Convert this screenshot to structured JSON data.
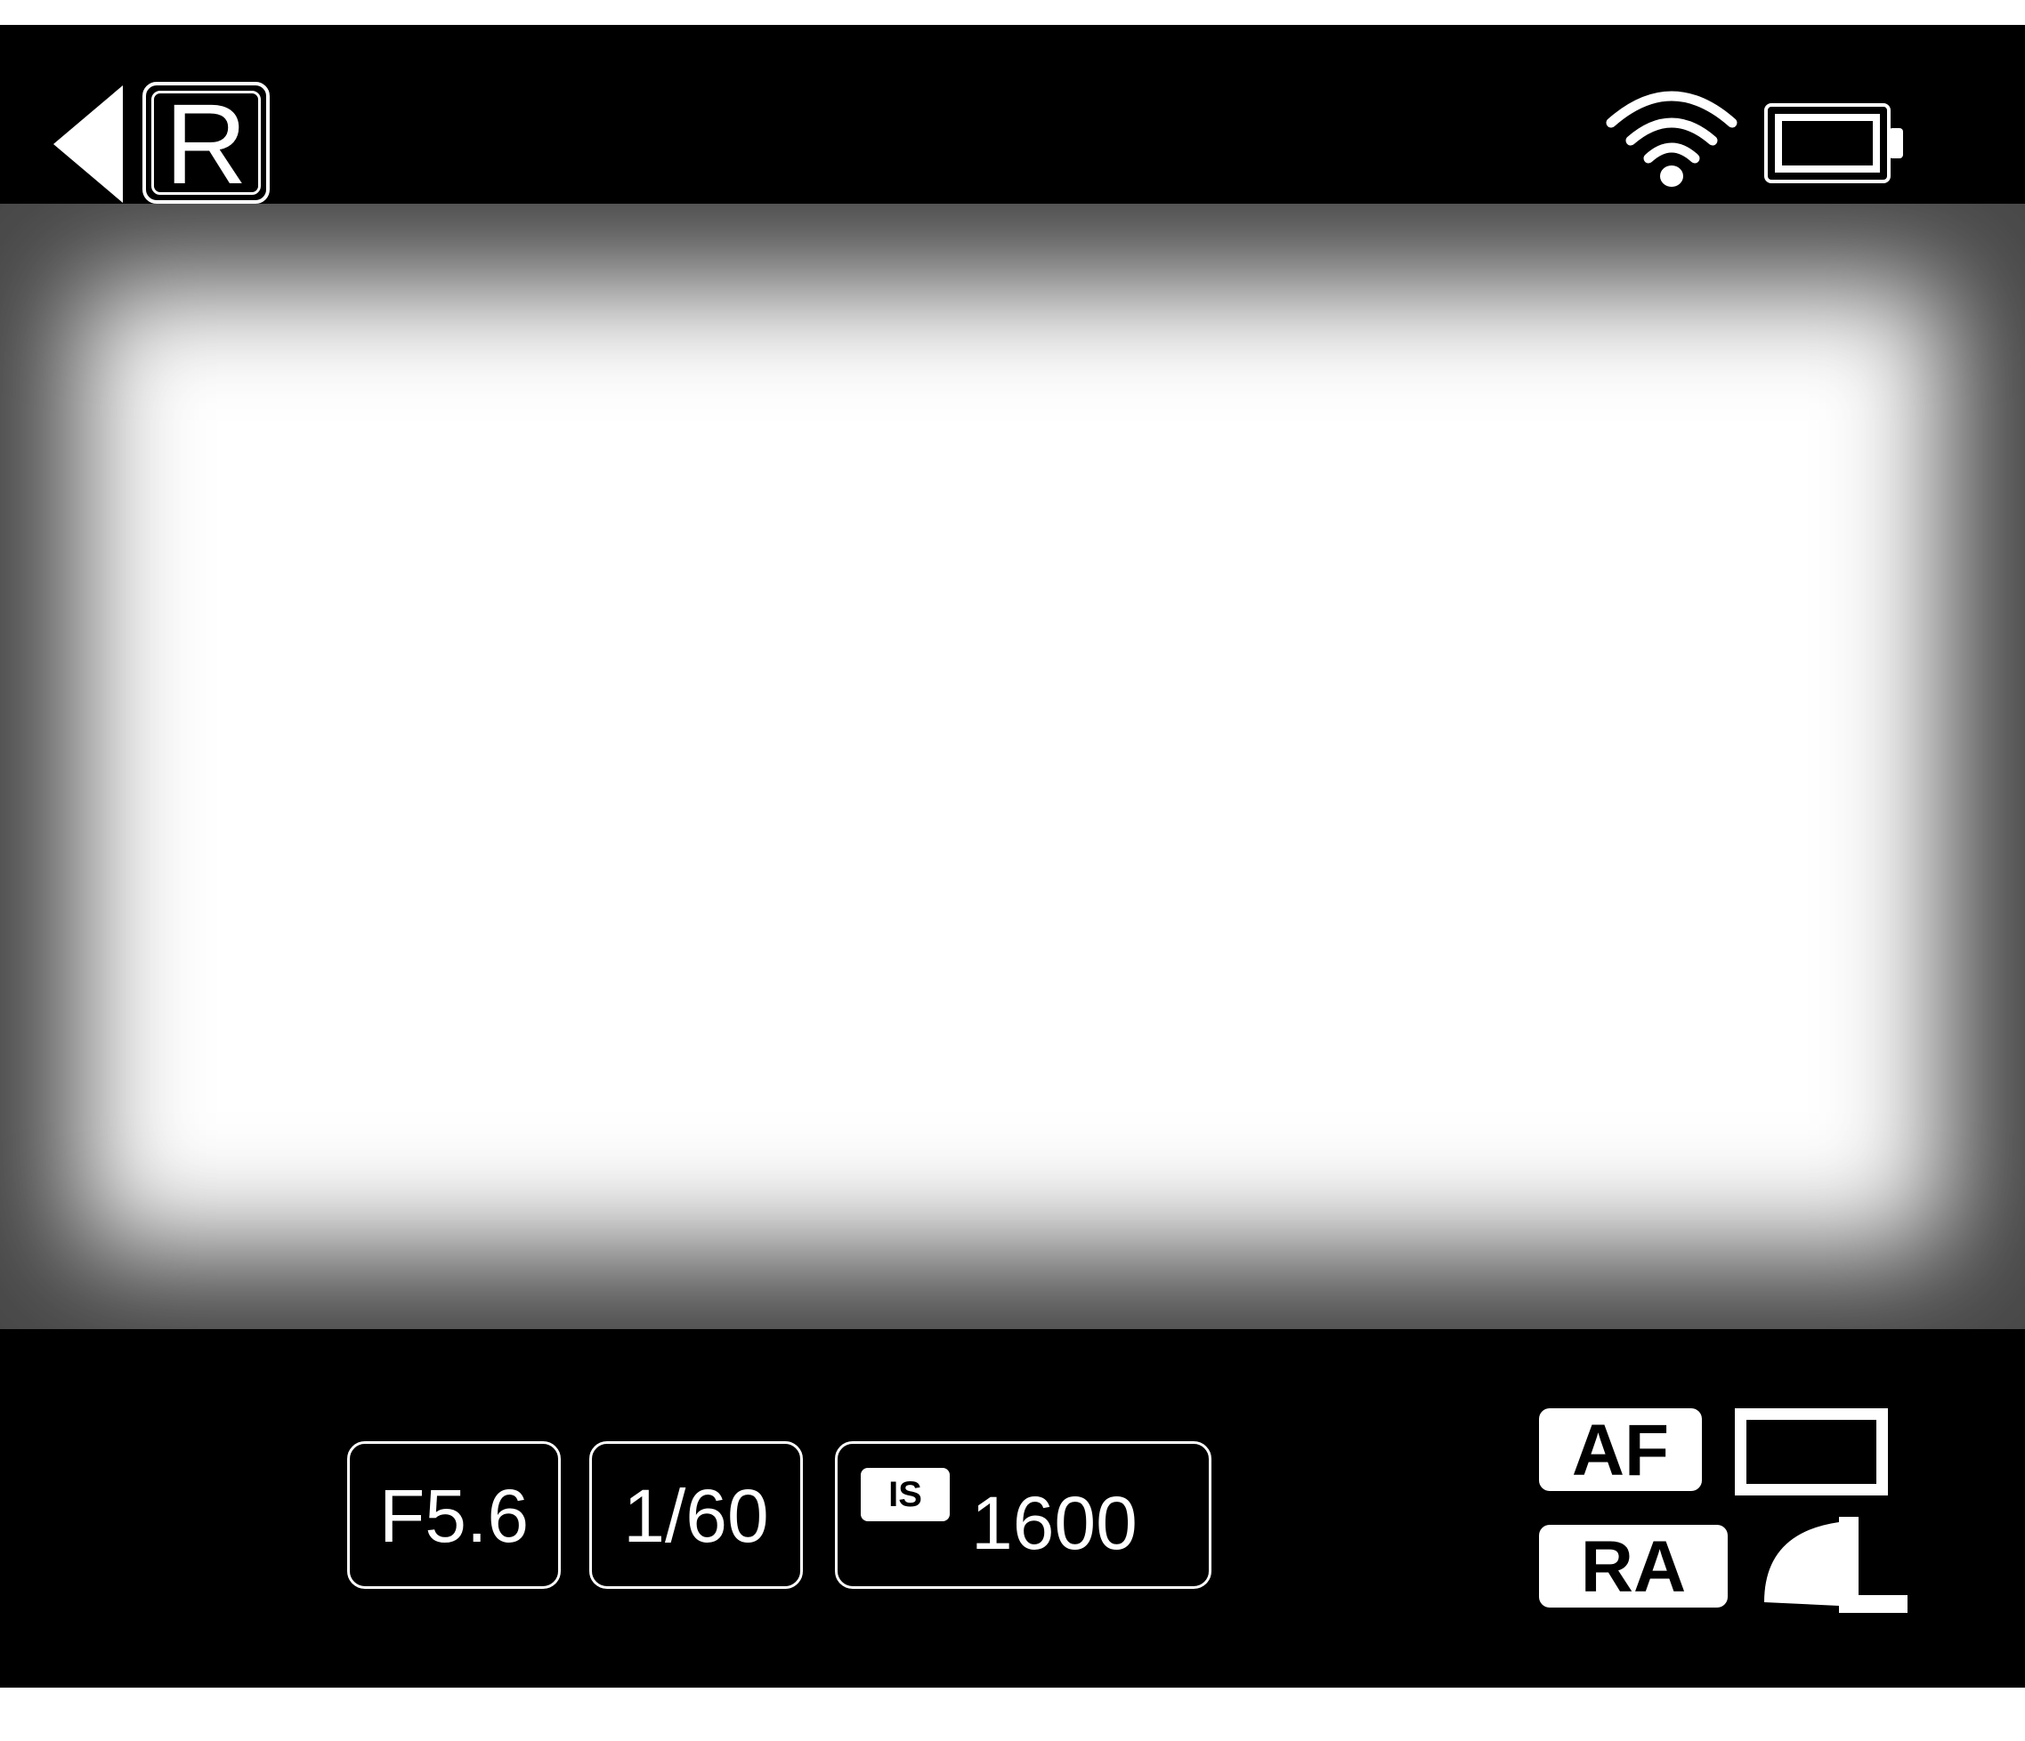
{
  "colors": {
    "bar_background": "#000000",
    "foreground": "#ffffff",
    "viewfinder": "#ffffff"
  },
  "top_bar": {
    "back_icon": "triangle-left-icon",
    "mode_label": "R",
    "wifi_icon": "wifi-icon",
    "battery_icon": "battery-icon",
    "battery_level": 1.0
  },
  "exposure": {
    "aperture": "F5.6",
    "shutter": "1/60",
    "iso_tag": "IS",
    "iso_value": "1600"
  },
  "status": {
    "af_label": "AF",
    "ra_label": "RA",
    "aspect_icon": "aspect-ratio-icon",
    "image_size_icon": "image-size-large-icon"
  }
}
